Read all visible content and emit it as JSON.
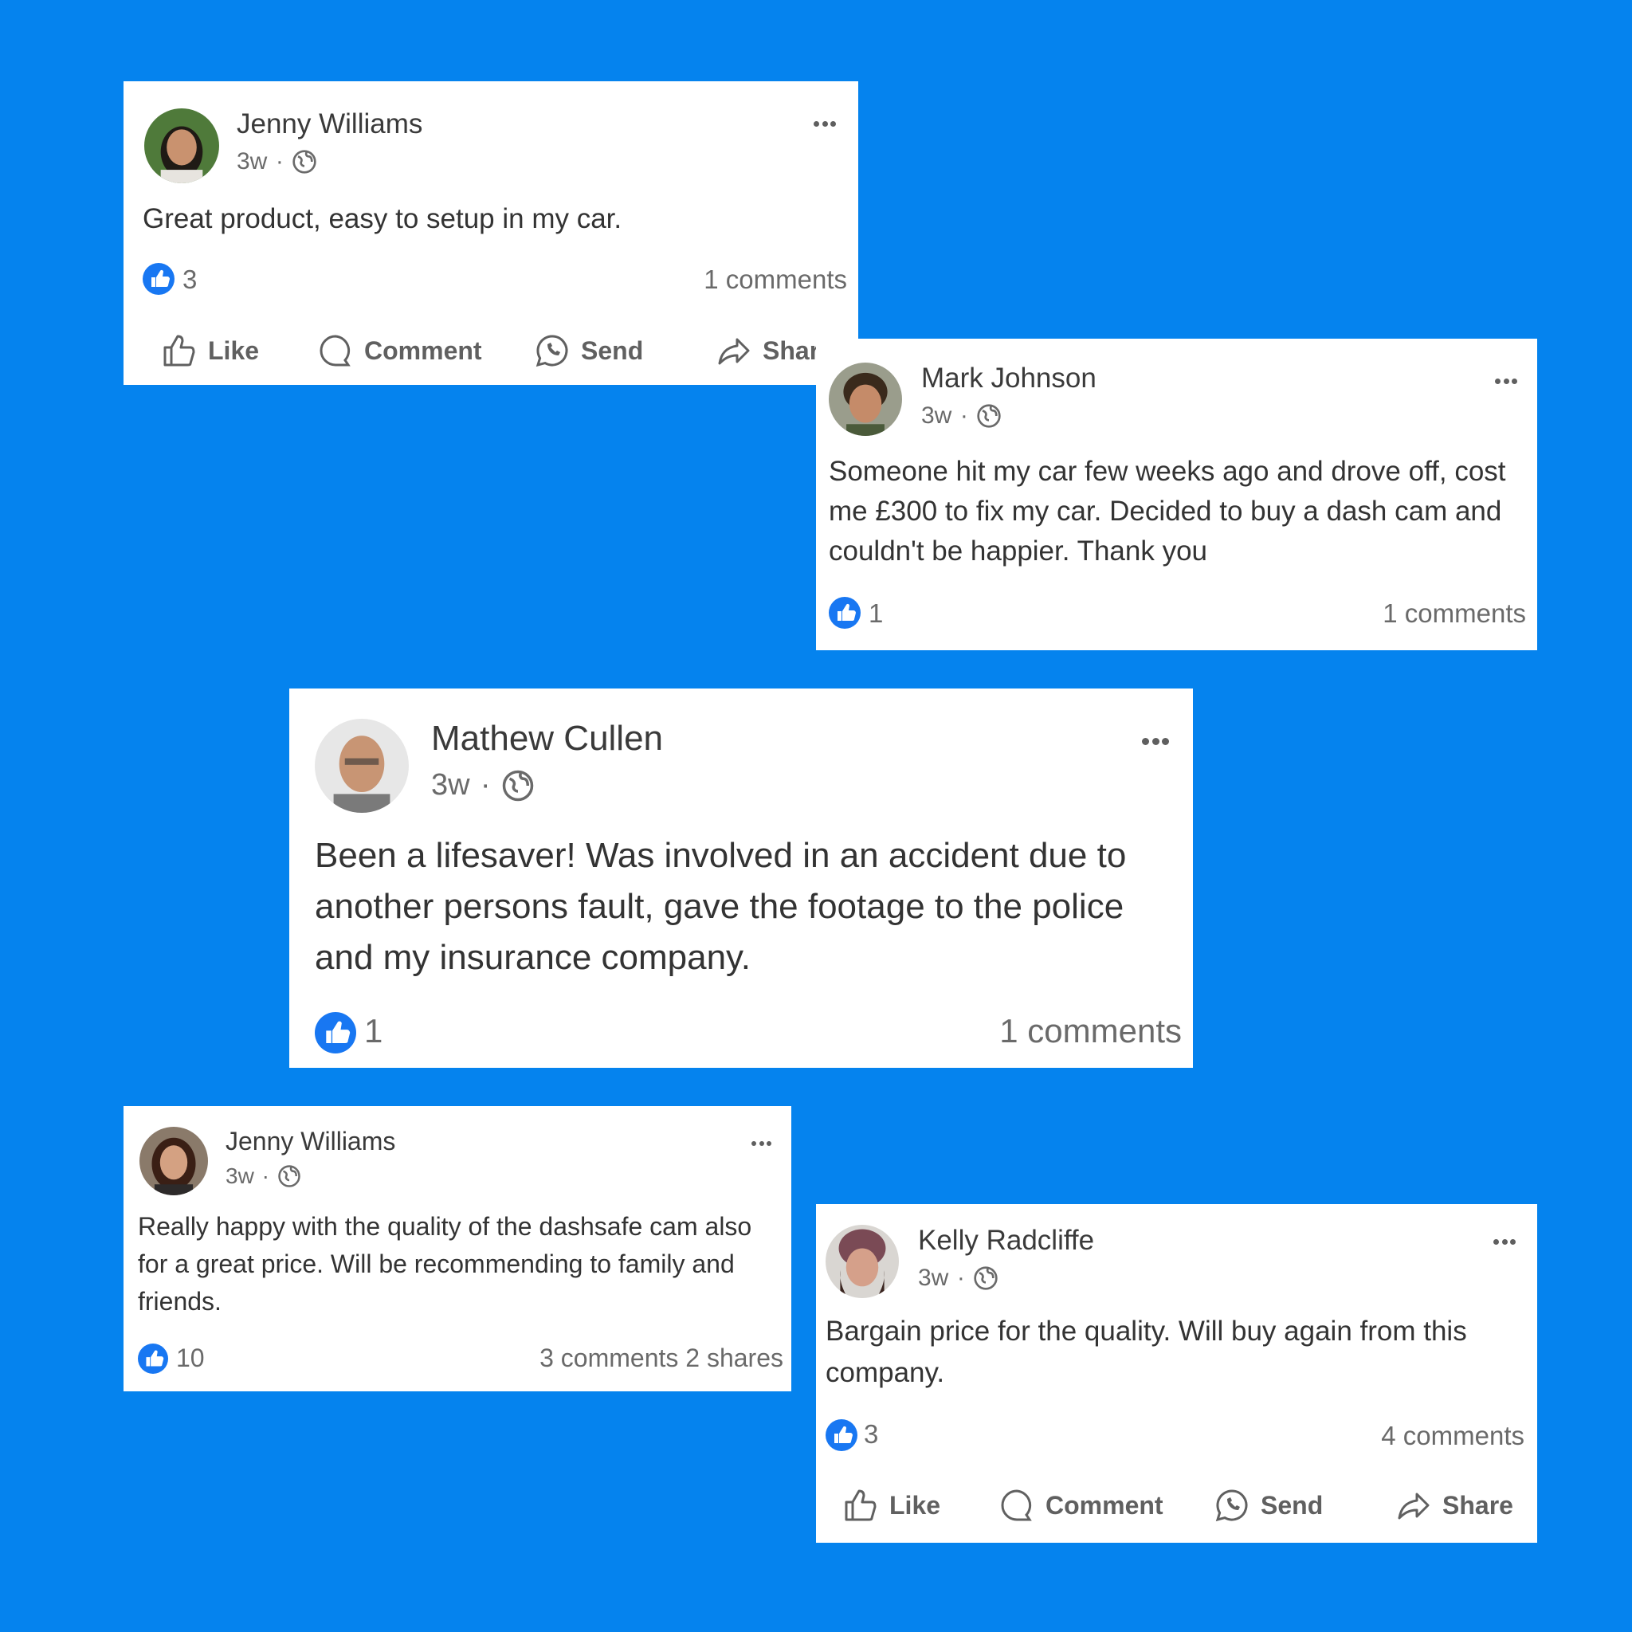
{
  "background_color": "#0583EE",
  "like_badge_color": "#1877F2",
  "posts": [
    {
      "author": "Jenny Williams",
      "time": "3w",
      "separator": "·",
      "privacy_icon": "globe-icon",
      "text": "Great product, easy to setup in my car.",
      "likes": "3",
      "stats": "1 comments",
      "actions": [
        "Like",
        "Comment",
        "Send",
        "Share"
      ]
    },
    {
      "author": "Mark Johnson",
      "time": "3w",
      "separator": "·",
      "privacy_icon": "globe-icon",
      "text": "Someone hit my car few weeks ago and drove off, cost me £300 to fix my car. Decided to buy a dash cam and couldn't be happier. Thank you",
      "likes": "1",
      "stats": "1 comments"
    },
    {
      "author": "Mathew Cullen",
      "time": "3w",
      "separator": "·",
      "privacy_icon": "globe-icon",
      "text": "Been a lifesaver! Was involved in an accident due to another persons fault, gave the footage to the police and my insurance company.",
      "likes": "1",
      "stats": "1 comments"
    },
    {
      "author": "Jenny Williams",
      "time": "3w",
      "separator": "·",
      "privacy_icon": "globe-icon",
      "text": "Really happy with the quality of the dashsafe cam also for a great price. Will be recommending to family and friends.",
      "likes": "10",
      "stats": "3 comments 2 shares"
    },
    {
      "author": "Kelly Radcliffe",
      "time": "3w",
      "separator": "·",
      "privacy_icon": "globe-icon",
      "text": "Bargain price for the quality. Will buy again from this company.",
      "likes": "3",
      "stats": "4 comments",
      "actions": [
        "Like",
        "Comment",
        "Send",
        "Share"
      ]
    }
  ]
}
